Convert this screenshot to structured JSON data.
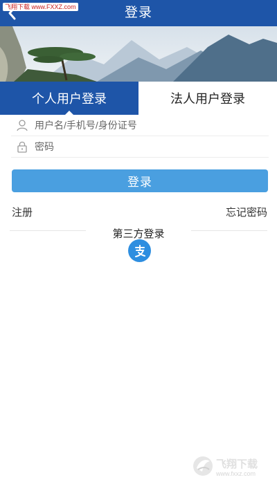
{
  "watermark": "飞翔下载 www.FXXZ.com",
  "header": {
    "title": "登录",
    "back_icon": "chevron-left-icon",
    "bg_color": "#1e55a8"
  },
  "tabs": [
    {
      "label": "个人用户登录",
      "active": true
    },
    {
      "label": "法人用户登录",
      "active": false
    }
  ],
  "form": {
    "username": {
      "placeholder": "用户名/手机号/身份证号",
      "value": "",
      "icon": "user-icon"
    },
    "password": {
      "placeholder": "密码",
      "value": "",
      "icon": "lock-icon"
    },
    "login_label": "登录",
    "login_color": "#4a9fe0"
  },
  "links": {
    "register": "注册",
    "forgot": "忘记密码"
  },
  "third_party": {
    "label": "第三方登录",
    "providers": [
      {
        "icon": "alipay-icon",
        "color": "#2e8ee0"
      }
    ]
  },
  "corner_watermark": {
    "brand": "飞翔下载",
    "url": "www.fxxz.com"
  }
}
